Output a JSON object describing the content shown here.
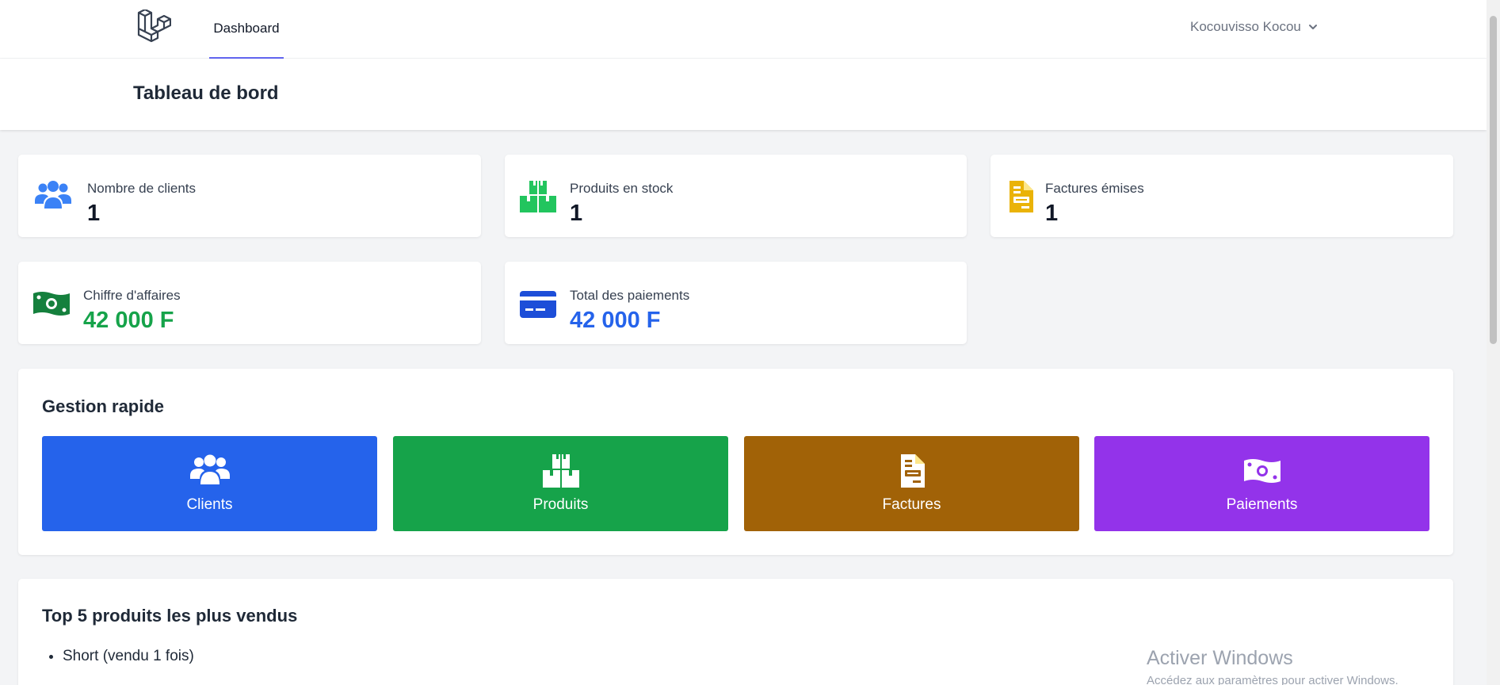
{
  "nav": {
    "logo_icon": "laravel-logo",
    "links": [
      {
        "label": "Dashboard",
        "active": true
      }
    ],
    "user_name": "Kocouvisso Kocou",
    "user_menu_icon": "chevron-down-icon"
  },
  "header": {
    "title": "Tableau de bord"
  },
  "stats": [
    {
      "label": "Nombre de clients",
      "value": "1",
      "icon": "users-icon",
      "icon_color": "#3b82f6",
      "value_color": "#111827"
    },
    {
      "label": "Produits en stock",
      "value": "1",
      "icon": "boxes-icon",
      "icon_color": "#22c55e",
      "value_color": "#111827"
    },
    {
      "label": "Factures émises",
      "value": "1",
      "icon": "invoice-icon",
      "icon_color": "#eab308",
      "value_color": "#111827"
    },
    {
      "label": "Chiffre d'affaires",
      "value": "42 000 F",
      "icon": "money-bill-icon",
      "icon_color": "#15803d",
      "value_color": "#16a34a"
    },
    {
      "label": "Total des paiements",
      "value": "42 000 F",
      "icon": "credit-card-icon",
      "icon_color": "#1d4ed8",
      "value_color": "#2563eb"
    }
  ],
  "quick": {
    "title": "Gestion rapide",
    "buttons": [
      {
        "label": "Clients",
        "icon": "users-icon",
        "color": "#2563eb"
      },
      {
        "label": "Produits",
        "icon": "boxes-icon",
        "color": "#16a34a"
      },
      {
        "label": "Factures",
        "icon": "invoice-icon",
        "color": "#a16207"
      },
      {
        "label": "Paiements",
        "icon": "money-bill-icon",
        "color": "#9333ea"
      }
    ]
  },
  "top_products": {
    "title": "Top 5 produits les plus vendus",
    "items": [
      "Short (vendu 1 fois)"
    ]
  },
  "watermark": {
    "title": "Activer Windows",
    "subtitle": "Accédez aux paramètres pour activer Windows."
  }
}
